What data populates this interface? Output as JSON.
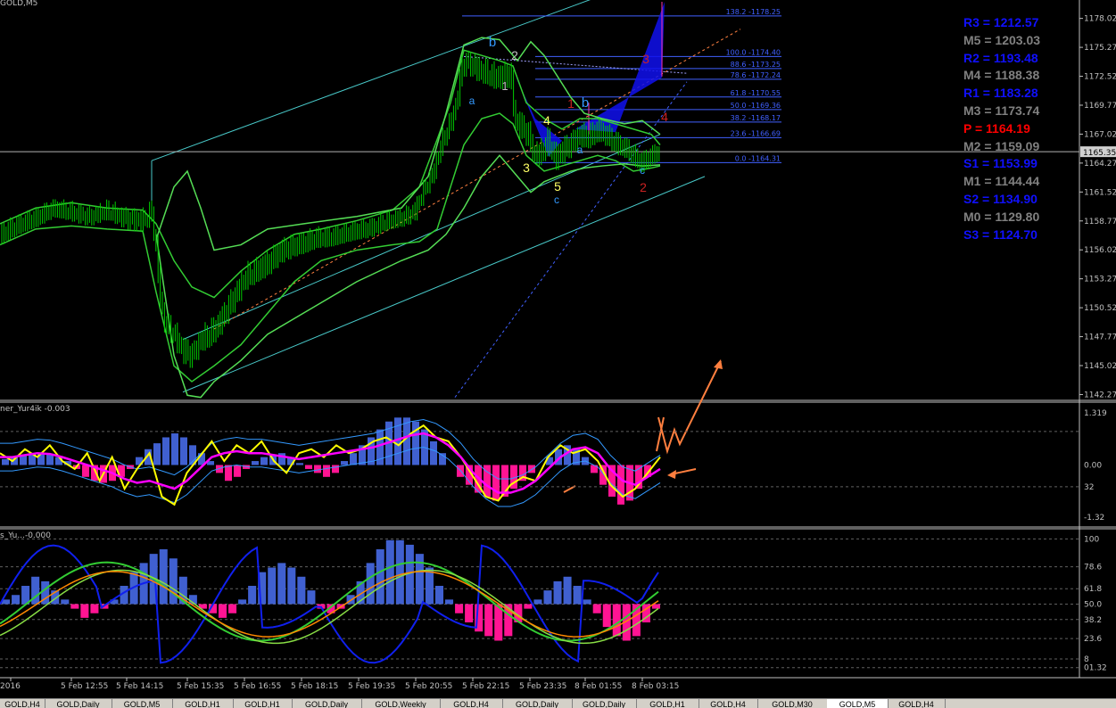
{
  "window": {
    "main_title": "GOLD,M5",
    "ind1_title": "ner_Yur4ik -0.003",
    "ind2_title": "s_Yu...-0.000"
  },
  "current_price": "1165.35",
  "colors": {
    "background": "#000000",
    "candle": "#00cc00",
    "band": "#33cc33",
    "channel": "#48c8c8",
    "fib": "#4060ff",
    "pattern_fill": "#1010ee",
    "pivot_blue": "#1010ff",
    "pivot_gray": "#808080",
    "pivot_red": "#ff0000",
    "hist_pos": "#4060d0",
    "hist_neg": "#ff1493",
    "fast_line": "#ffff00",
    "slow_line": "#ff00ff",
    "arrow": "#ff7f3f"
  },
  "chart_data": [
    {
      "type": "candlestick",
      "title": "GOLD,M5",
      "ylim": [
        1141.8,
        1179.6
      ],
      "y_ticks": [
        "1178.02",
        "1175.27",
        "1172.52",
        "1169.77",
        "1167.02",
        "1164.27",
        "1161.52",
        "1158.77",
        "1156.02",
        "1153.27",
        "1150.52",
        "1147.77",
        "1145.02",
        "1142.27"
      ],
      "x_ticks": [
        "2016",
        "5 Feb 12:55",
        "5 Feb 14:15",
        "5 Feb 15:35",
        "5 Feb 16:55",
        "5 Feb 18:15",
        "5 Feb 19:35",
        "5 Feb 20:55",
        "5 Feb 22:15",
        "5 Feb 23:35",
        "8 Feb 01:55",
        "8 Feb 03:15"
      ],
      "close_path": [
        [
          0,
          1157.5
        ],
        [
          20,
          1158.4
        ],
        [
          40,
          1159.0
        ],
        [
          60,
          1159.9
        ],
        [
          80,
          1159.5
        ],
        [
          100,
          1159.0
        ],
        [
          120,
          1159.5
        ],
        [
          140,
          1158.9
        ],
        [
          160,
          1158.7
        ],
        [
          170,
          1159.5
        ],
        [
          175,
          1156.0
        ],
        [
          180,
          1151.0
        ],
        [
          185,
          1149.0
        ],
        [
          195,
          1148.0
        ],
        [
          205,
          1146.5
        ],
        [
          215,
          1146.0
        ],
        [
          225,
          1147.5
        ],
        [
          235,
          1148.0
        ],
        [
          245,
          1149.0
        ],
        [
          255,
          1150.5
        ],
        [
          265,
          1152.0
        ],
        [
          275,
          1153.5
        ],
        [
          285,
          1154.0
        ],
        [
          300,
          1154.8
        ],
        [
          315,
          1156.0
        ],
        [
          330,
          1156.5
        ],
        [
          340,
          1156.7
        ],
        [
          355,
          1157.2
        ],
        [
          370,
          1157.2
        ],
        [
          385,
          1157.5
        ],
        [
          400,
          1157.8
        ],
        [
          415,
          1158.0
        ],
        [
          430,
          1158.5
        ],
        [
          445,
          1158.8
        ],
        [
          455,
          1159.0
        ],
        [
          465,
          1159.5
        ],
        [
          475,
          1161.5
        ],
        [
          485,
          1163.0
        ],
        [
          495,
          1166.0
        ],
        [
          505,
          1168.0
        ],
        [
          512,
          1170.0
        ],
        [
          518,
          1173.5
        ],
        [
          525,
          1173.8
        ],
        [
          535,
          1173.2
        ],
        [
          545,
          1172.8
        ],
        [
          555,
          1172.4
        ],
        [
          565,
          1172.6
        ],
        [
          572,
          1172.8
        ],
        [
          578,
          1168.2
        ],
        [
          585,
          1167.8
        ],
        [
          592,
          1167.0
        ],
        [
          600,
          1165.0
        ],
        [
          608,
          1165.5
        ],
        [
          615,
          1166.5
        ],
        [
          622,
          1164.8
        ],
        [
          630,
          1165.5
        ],
        [
          640,
          1166.2
        ],
        [
          650,
          1167.0
        ],
        [
          660,
          1166.8
        ],
        [
          670,
          1167.5
        ],
        [
          680,
          1167.0
        ],
        [
          690,
          1166.2
        ],
        [
          700,
          1165.8
        ],
        [
          710,
          1165.0
        ],
        [
          720,
          1164.3
        ],
        [
          730,
          1165.0
        ],
        [
          740,
          1165.3
        ]
      ],
      "band_upper": [
        [
          0,
          1158.5
        ],
        [
          40,
          1160.0
        ],
        [
          80,
          1160.5
        ],
        [
          120,
          1160.0
        ],
        [
          160,
          1159.8
        ],
        [
          175,
          1158.5
        ],
        [
          195,
          1155.0
        ],
        [
          215,
          1152.5
        ],
        [
          240,
          1151.5
        ],
        [
          270,
          1154.0
        ],
        [
          300,
          1156.0
        ],
        [
          330,
          1157.5
        ],
        [
          360,
          1158.0
        ],
        [
          400,
          1158.8
        ],
        [
          440,
          1159.8
        ],
        [
          470,
          1162.0
        ],
        [
          490,
          1166.5
        ],
        [
          505,
          1170.0
        ],
        [
          520,
          1175.0
        ],
        [
          540,
          1174.5
        ],
        [
          560,
          1174.0
        ],
        [
          575,
          1173.5
        ],
        [
          590,
          1170.0
        ],
        [
          610,
          1168.5
        ],
        [
          630,
          1167.5
        ],
        [
          650,
          1168.5
        ],
        [
          670,
          1168.5
        ],
        [
          690,
          1168.0
        ],
        [
          710,
          1167.5
        ],
        [
          730,
          1167.0
        ],
        [
          740,
          1166.0
        ]
      ],
      "band_lower": [
        [
          0,
          1156.5
        ],
        [
          40,
          1158.0
        ],
        [
          80,
          1158.3
        ],
        [
          120,
          1158.0
        ],
        [
          160,
          1157.8
        ],
        [
          175,
          1152.0
        ],
        [
          195,
          1145.0
        ],
        [
          215,
          1143.5
        ],
        [
          240,
          1145.0
        ],
        [
          270,
          1147.0
        ],
        [
          300,
          1150.0
        ],
        [
          330,
          1153.0
        ],
        [
          360,
          1155.0
        ],
        [
          400,
          1156.0
        ],
        [
          440,
          1156.5
        ],
        [
          470,
          1156.8
        ],
        [
          490,
          1158.0
        ],
        [
          505,
          1162.0
        ],
        [
          520,
          1166.0
        ],
        [
          540,
          1168.5
        ],
        [
          560,
          1169.0
        ],
        [
          575,
          1168.0
        ],
        [
          590,
          1165.0
        ],
        [
          610,
          1163.5
        ],
        [
          630,
          1164.0
        ],
        [
          650,
          1164.5
        ],
        [
          670,
          1165.0
        ],
        [
          690,
          1164.5
        ],
        [
          710,
          1163.5
        ],
        [
          730,
          1163.8
        ],
        [
          740,
          1164.0
        ]
      ],
      "band_wide_upper": [
        [
          175,
          1157.0
        ],
        [
          195,
          1162.0
        ],
        [
          210,
          1163.5
        ],
        [
          225,
          1160.0
        ],
        [
          240,
          1156.0
        ],
        [
          270,
          1156.5
        ],
        [
          300,
          1158.0
        ],
        [
          340,
          1158.5
        ],
        [
          400,
          1159.2
        ],
        [
          450,
          1160.0
        ],
        [
          480,
          1163.0
        ],
        [
          500,
          1169.0
        ],
        [
          520,
          1175.5
        ],
        [
          540,
          1176.2
        ],
        [
          560,
          1176.0
        ],
        [
          580,
          1174.0
        ],
        [
          595,
          1175.8
        ],
        [
          610,
          1174.5
        ],
        [
          625,
          1172.5
        ],
        [
          640,
          1170.5
        ],
        [
          655,
          1169.0
        ],
        [
          675,
          1168.5
        ],
        [
          700,
          1168.0
        ],
        [
          720,
          1168.3
        ],
        [
          740,
          1167.0
        ]
      ],
      "band_wide_lower": [
        [
          175,
          1157.5
        ],
        [
          195,
          1146.0
        ],
        [
          210,
          1142.2
        ],
        [
          225,
          1142.0
        ],
        [
          240,
          1143.5
        ],
        [
          270,
          1145.5
        ],
        [
          300,
          1148.0
        ],
        [
          340,
          1150.0
        ],
        [
          400,
          1153.0
        ],
        [
          450,
          1155.0
        ],
        [
          480,
          1156.0
        ],
        [
          500,
          1157.5
        ],
        [
          520,
          1160.0
        ],
        [
          540,
          1163.0
        ],
        [
          560,
          1165.0
        ],
        [
          580,
          1163.0
        ],
        [
          595,
          1161.5
        ],
        [
          610,
          1162.5
        ],
        [
          625,
          1163.0
        ],
        [
          640,
          1163.5
        ],
        [
          655,
          1163.8
        ],
        [
          675,
          1164.0
        ],
        [
          700,
          1164.2
        ],
        [
          720,
          1164.0
        ],
        [
          740,
          1164.1
        ]
      ]
    },
    {
      "type": "histogram_lines",
      "title": "ner_Yur4ik -0.003",
      "ylim": [
        -1.5,
        1.5
      ],
      "y_ticks": [
        "1.319",
        "0.00",
        "32",
        "-1.32"
      ],
      "histogram": [
        0.15,
        0.2,
        0.25,
        0.3,
        0.3,
        0.28,
        0.2,
        0.1,
        -0.1,
        -0.3,
        -0.4,
        -0.45,
        -0.4,
        -0.3,
        -0.1,
        0.2,
        0.4,
        0.55,
        0.7,
        0.8,
        0.7,
        0.5,
        0.3,
        0.1,
        -0.2,
        -0.4,
        -0.3,
        -0.1,
        0.1,
        0.2,
        0.25,
        0.3,
        0.2,
        0.05,
        -0.1,
        -0.2,
        -0.3,
        -0.2,
        0.1,
        0.3,
        0.5,
        0.7,
        0.9,
        1.1,
        1.2,
        1.2,
        1.1,
        0.9,
        0.6,
        0.3,
        0.0,
        -0.3,
        -0.5,
        -0.7,
        -0.8,
        -0.9,
        -0.8,
        -0.6,
        -0.4,
        -0.2,
        0.0,
        0.2,
        0.4,
        0.5,
        0.4,
        0.2,
        -0.2,
        -0.5,
        -0.8,
        -1.0,
        -0.9,
        -0.6,
        -0.3,
        0.0
      ],
      "fast_line": [
        0.3,
        0.1,
        0.4,
        0.2,
        0.5,
        0.1,
        -0.1,
        0.3,
        -0.4,
        0.2,
        -0.6,
        -0.1,
        0.3,
        -0.8,
        -1.0,
        -0.2,
        0.2,
        0.6,
        0.1,
        0.5,
        0.3,
        0.6,
        0.1,
        -0.2,
        0.3,
        0.4,
        0.2,
        0.5,
        0.3,
        0.4,
        0.6,
        0.7,
        0.5,
        0.8,
        1.0,
        0.7,
        0.6,
        0.2,
        -0.3,
        -0.8,
        -0.9,
        -0.5,
        -0.3,
        -0.4,
        0.2,
        0.5,
        0.3,
        0.4,
        0.1,
        -0.5,
        -0.8,
        -0.6,
        -0.2,
        0.2
      ],
      "slow_line": [
        0.2,
        0.2,
        0.25,
        0.3,
        0.28,
        0.2,
        0.1,
        0.0,
        -0.1,
        -0.2,
        -0.35,
        -0.45,
        -0.4,
        -0.5,
        -0.6,
        -0.4,
        -0.1,
        0.2,
        0.3,
        0.35,
        0.3,
        0.3,
        0.25,
        0.2,
        0.15,
        0.2,
        0.25,
        0.3,
        0.35,
        0.4,
        0.45,
        0.55,
        0.65,
        0.75,
        0.8,
        0.7,
        0.5,
        0.2,
        -0.2,
        -0.5,
        -0.7,
        -0.7,
        -0.6,
        -0.4,
        -0.1,
        0.2,
        0.4,
        0.45,
        0.3,
        -0.1,
        -0.4,
        -0.5,
        -0.3,
        -0.1
      ]
    },
    {
      "type": "histogram_lines",
      "title": "s_Yu...-0.000",
      "ylim": [
        -5,
        105
      ],
      "y_ticks": [
        "100",
        "78.6",
        "61.8",
        "50.0",
        "38.2",
        "23.6",
        "8",
        "01.32"
      ],
      "histogram": [
        5,
        10,
        20,
        30,
        25,
        15,
        5,
        -5,
        -15,
        -10,
        -5,
        5,
        20,
        35,
        45,
        55,
        60,
        50,
        30,
        10,
        -5,
        -10,
        -15,
        -10,
        5,
        20,
        35,
        40,
        45,
        40,
        30,
        15,
        -5,
        -10,
        -5,
        10,
        25,
        45,
        60,
        70,
        70,
        65,
        55,
        40,
        20,
        5,
        -10,
        -20,
        -30,
        -35,
        -40,
        -35,
        -20,
        -5,
        5,
        15,
        25,
        30,
        20,
        5,
        -10,
        -25,
        -35,
        -40,
        -35,
        -20,
        -5
      ]
    }
  ],
  "fib_levels": [
    {
      "label": "138.2 -1178.25",
      "price": 1178.25
    },
    {
      "label": "100.0 -1174.40",
      "price": 1174.4
    },
    {
      "label": "88.6 -1173.25",
      "price": 1173.25
    },
    {
      "label": "78.6 -1172.24",
      "price": 1172.24
    },
    {
      "label": "61.8 -1170.55",
      "price": 1170.55
    },
    {
      "label": "50.0 -1169.36",
      "price": 1169.36
    },
    {
      "label": "38.2 -1168.17",
      "price": 1168.17
    },
    {
      "label": "23.6 -1166.69",
      "price": 1166.69
    },
    {
      "label": "0.0 -1164.31",
      "price": 1164.31
    }
  ],
  "pivots": [
    {
      "label": "R3 = 1212.57",
      "color": "#1010ff"
    },
    {
      "label": "M5 = 1203.03",
      "color": "#808080"
    },
    {
      "label": "R2 = 1193.48",
      "color": "#1010ff"
    },
    {
      "label": "M4 = 1188.38",
      "color": "#808080"
    },
    {
      "label": "R1 = 1183.28",
      "color": "#1010ff"
    },
    {
      "label": "M3 = 1173.74",
      "color": "#808080"
    },
    {
      "label": "P   = 1164.19",
      "color": "#ff0000"
    },
    {
      "label": "M2 = 1159.09",
      "color": "#808080"
    },
    {
      "label": "S1 = 1153.99",
      "color": "#1010ff"
    },
    {
      "label": "M1 = 1144.44",
      "color": "#808080"
    },
    {
      "label": "S2 = 1134.90",
      "color": "#1010ff"
    },
    {
      "label": "M0 = 1129.80",
      "color": "#808080"
    },
    {
      "label": "S3 = 1124.70",
      "color": "#1010ff"
    }
  ],
  "wave_labels": [
    {
      "text": "b",
      "color": "#3399ff"
    },
    {
      "text": "2",
      "color": "#c0c0c0"
    },
    {
      "text": "a",
      "color": "#3399ff"
    },
    {
      "text": "1",
      "color": "#c0c0c0"
    },
    {
      "text": "4",
      "color": "#ffff66"
    },
    {
      "text": "1",
      "color": "#cc2222"
    },
    {
      "text": "b",
      "color": "#3399ff"
    },
    {
      "text": "3",
      "color": "#cc2222"
    },
    {
      "text": "4",
      "color": "#cc2222"
    },
    {
      "text": "a",
      "color": "#3399ff"
    },
    {
      "text": "3",
      "color": "#ffff66"
    },
    {
      "text": "5",
      "color": "#ffff66"
    },
    {
      "text": "c",
      "color": "#3399ff"
    },
    {
      "text": "c",
      "color": "#3399ff"
    },
    {
      "text": "2",
      "color": "#cc2222"
    }
  ],
  "tabs": [
    "GOLD,H4",
    "GOLD,Daily",
    "GOLD,M5",
    "GOLD,H1",
    "GOLD,H1",
    "GOLD,Daily",
    "GOLD,Weekly",
    "GOLD,H4",
    "GOLD,Daily",
    "GOLD,Daily",
    "GOLD,H1",
    "GOLD,H4",
    "GOLD,M30",
    "GOLD,M5",
    "GOLD,H4"
  ],
  "active_tab": 13
}
